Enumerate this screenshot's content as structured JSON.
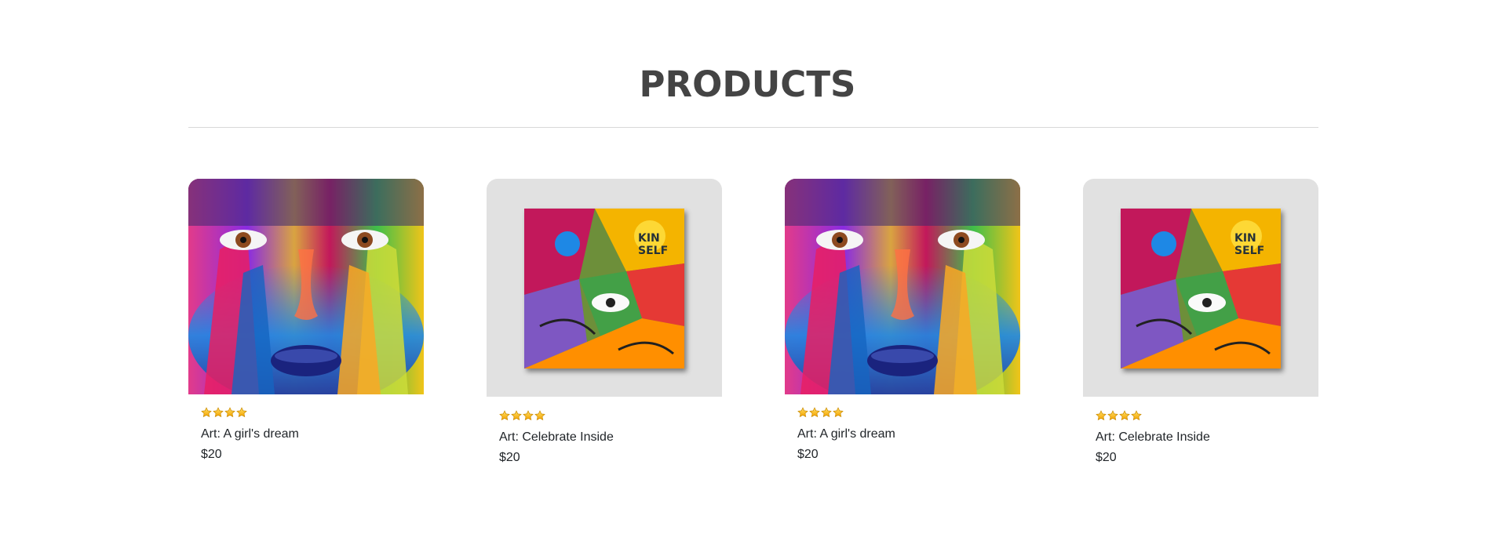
{
  "section": {
    "title": "PRODUCTS"
  },
  "products": [
    {
      "name": "Art: A girl's dream",
      "price": "$20",
      "rating": 4,
      "image": "painted-face-portrait"
    },
    {
      "name": "Art: Celebrate Inside",
      "price": "$20",
      "rating": 4,
      "image": "graffiti-collage"
    },
    {
      "name": "Art: A girl's dream",
      "price": "$20",
      "rating": 4,
      "image": "painted-face-portrait"
    },
    {
      "name": "Art: Celebrate Inside",
      "price": "$20",
      "rating": 4,
      "image": "graffiti-collage"
    }
  ],
  "icons": {
    "star": "star-icon"
  },
  "colors": {
    "title": "#444444",
    "star_fill": "#ffc400",
    "card_media_bg": "#e1e1e1",
    "text": "#212529"
  }
}
